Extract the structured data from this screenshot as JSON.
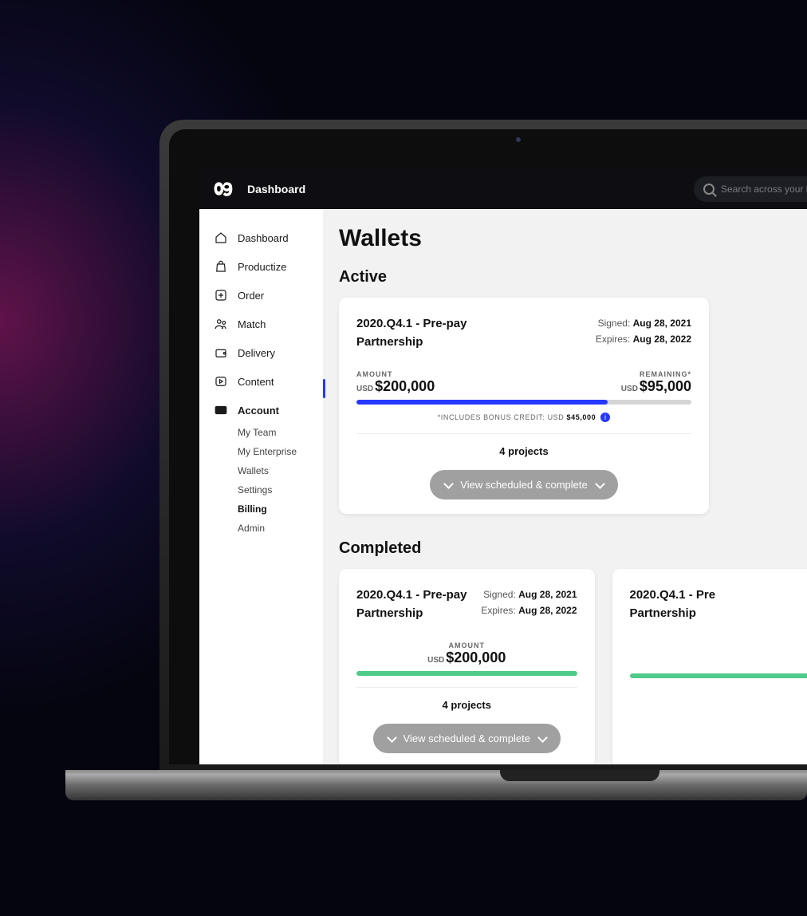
{
  "header": {
    "title": "Dashboard",
    "searchPlaceholder": "Search across your brand…"
  },
  "sidebar": {
    "items": [
      {
        "id": "dashboard",
        "label": "Dashboard"
      },
      {
        "id": "productize",
        "label": "Productize"
      },
      {
        "id": "order",
        "label": "Order"
      },
      {
        "id": "match",
        "label": "Match"
      },
      {
        "id": "delivery",
        "label": "Delivery"
      },
      {
        "id": "content",
        "label": "Content"
      },
      {
        "id": "account",
        "label": "Account"
      }
    ],
    "subItems": [
      {
        "label": "My Team"
      },
      {
        "label": "My Enterprise"
      },
      {
        "label": "Wallets"
      },
      {
        "label": "Settings"
      },
      {
        "label": "Billing"
      },
      {
        "label": "Admin"
      }
    ]
  },
  "page": {
    "title": "Wallets",
    "sections": {
      "active": "Active",
      "completed": "Completed"
    },
    "labels": {
      "signed": "Signed:",
      "expires": "Expires:",
      "amount": "AMOUNT",
      "remaining": "REMAINING*",
      "currency": "USD",
      "bonusPrefix": "*Includes bonus credit: USD",
      "viewButton": "View scheduled & complete"
    },
    "activeCard": {
      "titleLine1": "2020.Q4.1 - Pre-pay",
      "titleLine2": "Partnership",
      "signed": "Aug 28, 2021",
      "expires": "Aug 28, 2022",
      "amount": "$200,000",
      "remaining": "$95,000",
      "bonusCredit": "$45,000",
      "progressPct": 75,
      "projects": "4 projects"
    },
    "completedCards": [
      {
        "titleLine1": "2020.Q4.1 - Pre-pay",
        "titleLine2": "Partnership",
        "signed": "Aug 28, 2021",
        "expires": "Aug 28, 2022",
        "amount": "$200,000",
        "progressPct": 100,
        "projects": "4 projects"
      },
      {
        "titleLine1": "2020.Q4.1 - Pre",
        "titleLine2": "Partnership",
        "signed": "",
        "expires": "",
        "amount": "",
        "progressPct": 100,
        "projects": ""
      }
    ]
  }
}
